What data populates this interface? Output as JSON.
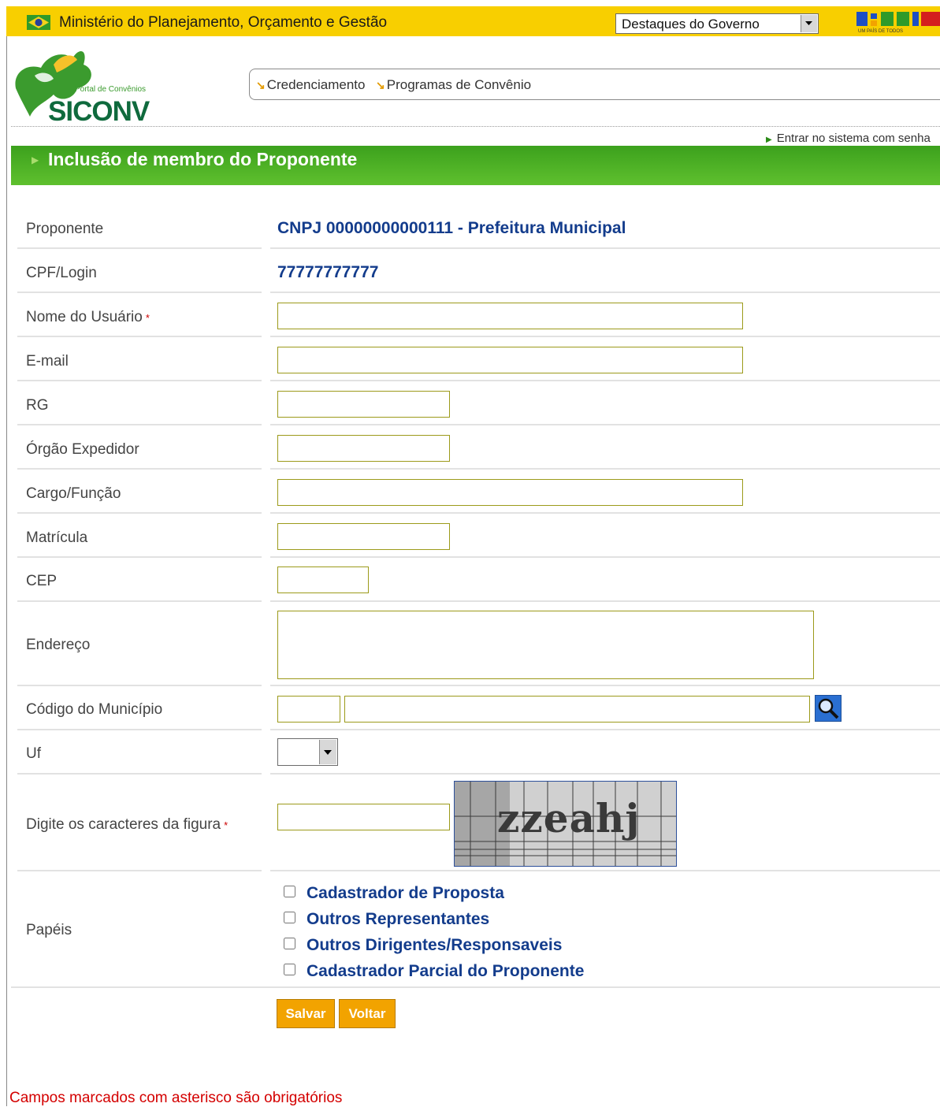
{
  "gov_bar": {
    "title": "Ministério do Planejamento, Orçamento e Gestão",
    "select_value": "Destaques do Governo",
    "brasil_logo_text": "BRASIL",
    "brasil_logo_subtitle": "UM PAÍS DE TODOS"
  },
  "logo": {
    "subtitle": "Portal de Convênios",
    "title": "SICONV"
  },
  "menu": {
    "items": [
      {
        "label": "Credenciamento"
      },
      {
        "label": "Programas de Convênio"
      }
    ]
  },
  "enter_link": "Entrar no sistema com senha",
  "page_title": "Inclusão de membro do Proponente",
  "form": {
    "proponente_label": "Proponente",
    "proponente_value": "CNPJ 00000000000111 - Prefeitura Municipal",
    "cpf_label": "CPF/Login",
    "cpf_value": "77777777777",
    "nome_label": "Nome do Usuário",
    "email_label": "E-mail",
    "rg_label": "RG",
    "orgao_label": "Órgão Expedidor",
    "cargo_label": "Cargo/Função",
    "matricula_label": "Matrícula",
    "cep_label": "CEP",
    "endereco_label": "Endereço",
    "municipio_label": "Código do Município",
    "uf_label": "Uf",
    "captcha_label": "Digite os caracteres da figura",
    "captcha_text": "zzeahj",
    "papeis_label": "Papéis",
    "required_mark": "*"
  },
  "roles": [
    "Cadastrador de Proposta",
    "Outros Representantes",
    "Outros Dirigentes/Responsaveis",
    "Cadastrador Parcial do Proponente"
  ],
  "buttons": {
    "save": "Salvar",
    "back": "Voltar"
  },
  "footnote": "Campos marcados com asterisco são obrigatórios",
  "colors": {
    "gov_bar": "#f8cf00",
    "title_bar": "#4cb126",
    "value_text": "#133c8c",
    "button": "#f2a300",
    "required": "#d40000"
  }
}
